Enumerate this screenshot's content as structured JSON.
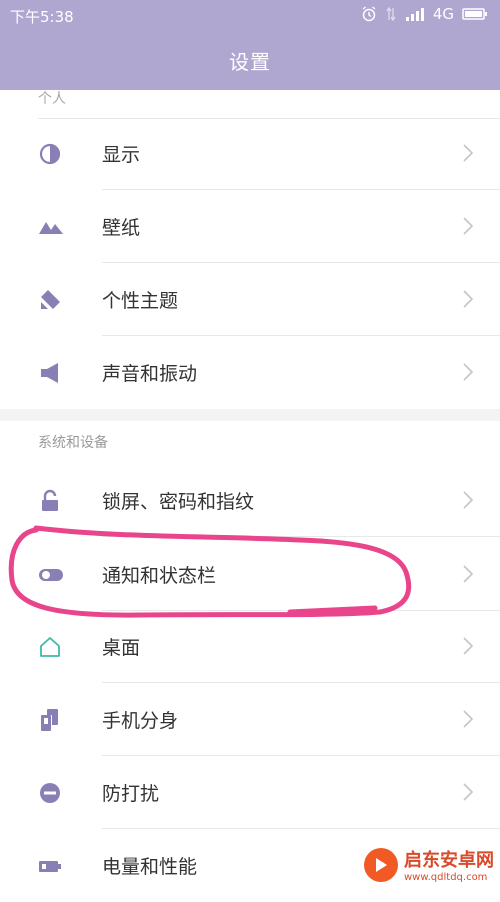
{
  "status_bar": {
    "time": "下午5:38",
    "network": "4G"
  },
  "header": {
    "title": "设置"
  },
  "sections": {
    "personal_clipped": "个人",
    "system_title": "系统和设备"
  },
  "personal_items": [
    {
      "label": "显示",
      "icon": "display-half-circle-icon"
    },
    {
      "label": "壁纸",
      "icon": "mountain-icon"
    },
    {
      "label": "个性主题",
      "icon": "paint-brush-icon"
    },
    {
      "label": "声音和振动",
      "icon": "speaker-icon"
    }
  ],
  "system_items": [
    {
      "label": "锁屏、密码和指纹",
      "icon": "lock-icon"
    },
    {
      "label": "通知和状态栏",
      "icon": "toggle-icon"
    },
    {
      "label": "桌面",
      "icon": "home-icon"
    },
    {
      "label": "手机分身",
      "icon": "dual-phone-icon"
    },
    {
      "label": "防打扰",
      "icon": "do-not-disturb-icon"
    },
    {
      "label": "电量和性能",
      "icon": "battery-icon"
    }
  ],
  "watermark": {
    "title": "启东安卓网",
    "url": "www.qdltdq.com"
  },
  "colors": {
    "header": "#b0a7d1",
    "icon": "#8a7fb5",
    "home_icon": "#3fb9a8",
    "highlight": "#e8458b"
  }
}
